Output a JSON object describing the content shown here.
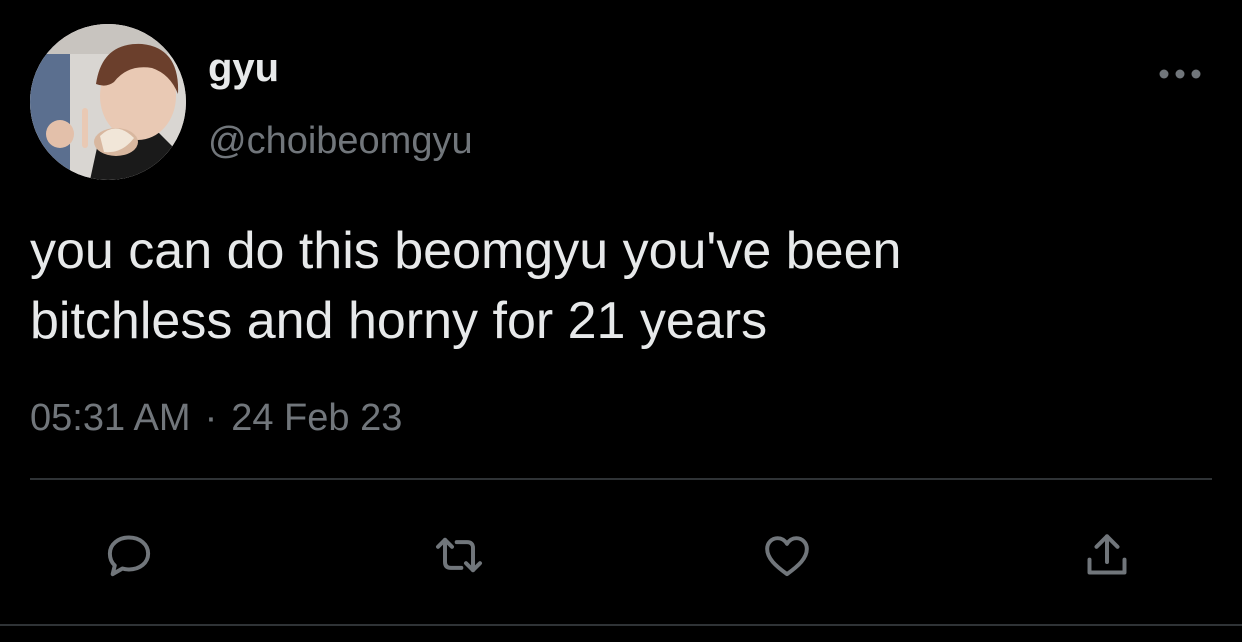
{
  "tweet": {
    "display_name": "gyu",
    "handle": "@choibeomgyu",
    "text": "you can do this beomgyu you've been\nbitchless and horny for 21 years",
    "time": "05:31 AM",
    "separator": "·",
    "date": "24 Feb 23"
  },
  "icons": {
    "more": "more-horizontal-icon",
    "reply": "reply-bubble-icon",
    "retweet": "retweet-icon",
    "like": "heart-icon",
    "share": "share-upload-icon"
  },
  "colors": {
    "background": "#000000",
    "text_primary": "#e7e9ea",
    "text_secondary": "#71767b",
    "divider": "#2f3336"
  }
}
